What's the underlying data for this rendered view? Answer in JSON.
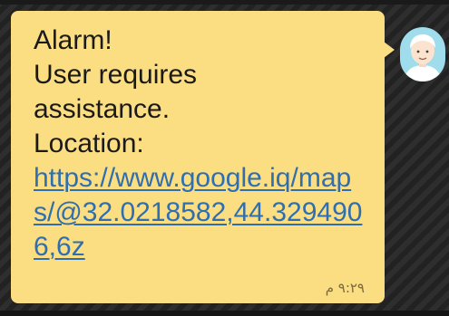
{
  "message": {
    "text_lines": "Alarm!\nUser requires\nassistance.\nLocation:",
    "link_text": "https://www.google.iq/maps/@32.0218582,44.3294906,6z",
    "timestamp": "٩:٢٩ م"
  },
  "contact": {
    "avatar_icon": "person-avatar-icon"
  },
  "colors": {
    "bubble": "#fbdd82",
    "link": "#2f6fb0",
    "avatar": "#9fdcec",
    "background": "#2a2a2a"
  }
}
